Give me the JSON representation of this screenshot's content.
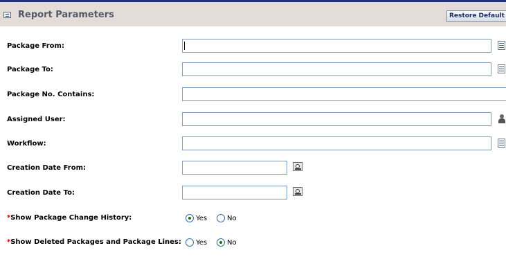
{
  "header": {
    "title": "Report Parameters",
    "restore_label": "Restore Default",
    "collapse_icon": "collapse-icon"
  },
  "fields": [
    {
      "label": "Package From:",
      "value": "",
      "icon": "list-icon"
    },
    {
      "label": "Package To:",
      "value": "",
      "icon": "list-icon"
    },
    {
      "label": "Package No. Contains:",
      "value": "",
      "icon": ""
    },
    {
      "label": "Assigned User:",
      "value": "",
      "icon": "user-icon"
    },
    {
      "label": "Workflow:",
      "value": "",
      "icon": "list-icon"
    },
    {
      "label": "Creation Date From:",
      "value": "",
      "icon": "calendar-icon"
    },
    {
      "label": "Creation Date To:",
      "value": "",
      "icon": "calendar-icon"
    }
  ],
  "radios": [
    {
      "required_mark": "*",
      "label": "Show Package Change History:",
      "yes": "Yes",
      "no": "No",
      "selected": "Yes"
    },
    {
      "required_mark": "*",
      "label": "Show Deleted Packages and Package Lines:",
      "yes": "Yes",
      "no": "No",
      "selected": "No"
    }
  ],
  "colors": {
    "header_bg": "#e4dcd9",
    "top_line": "#1d3470",
    "input_border": "#7f98b3",
    "required": "#d00000"
  }
}
